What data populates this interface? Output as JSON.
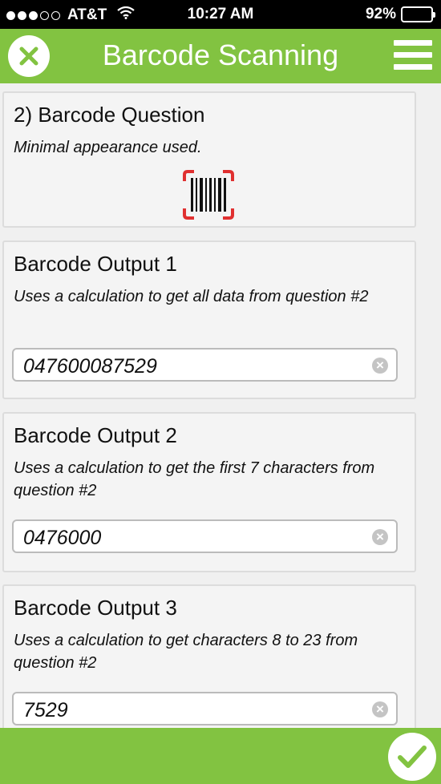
{
  "status_bar": {
    "carrier": "AT&T",
    "time": "10:27 AM",
    "battery": "92%",
    "battery_level": 0.92,
    "signal_bars": 3
  },
  "header": {
    "title": "Barcode Scanning",
    "accent_color": "#82c341"
  },
  "question": {
    "title": "2) Barcode Question",
    "hint": "Minimal appearance used.",
    "scan_icon": "barcode-scan-icon"
  },
  "outputs": [
    {
      "title": "Barcode Output 1",
      "hint": "Uses a calculation to get all data from question #2",
      "value": "047600087529"
    },
    {
      "title": "Barcode Output 2",
      "hint": "Uses a calculation to get the first 7 characters from question #2",
      "value": "0476000"
    },
    {
      "title": "Barcode Output 3",
      "hint": "Uses a calculation to get characters 8 to 23 from question #2",
      "value": "7529"
    }
  ]
}
